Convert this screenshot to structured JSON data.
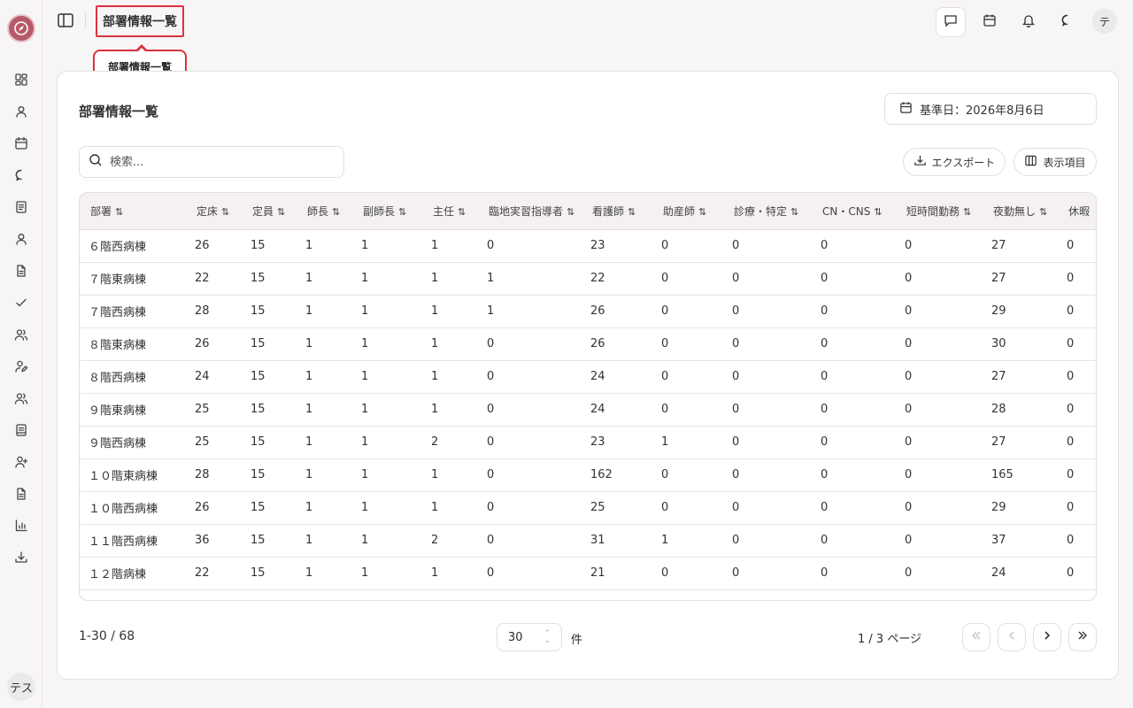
{
  "header": {
    "title": "部署情報一覧",
    "tooltip": "部署情報一覧",
    "avatar": "テ"
  },
  "sidebar": {
    "avatar": "テス",
    "icons": [
      "dashboard-icon",
      "user-icon",
      "calendar-icon",
      "chat-icon",
      "document-icon",
      "person-icon",
      "file-icon",
      "check-icon",
      "users-icon",
      "user-edit-icon",
      "group-icon",
      "notes-icon",
      "user-plus-icon",
      "report-icon",
      "bar-chart-icon",
      "download-icon"
    ]
  },
  "card": {
    "title": "部署情報一覧",
    "date_label": "基準日：2026年8月6日",
    "search_placeholder": "検索...",
    "export_label": "エクスポート",
    "columns_label": "表示項目"
  },
  "table": {
    "columns": [
      "部署",
      "定床",
      "定員",
      "師長",
      "副師長",
      "主任",
      "臨地実習指導者",
      "看護師",
      "助産師",
      "診療・特定",
      "CN・CNS",
      "短時間勤務",
      "夜勤無し",
      "休暇"
    ],
    "rows": [
      [
        "６階西病棟",
        "26",
        "15",
        "1",
        "1",
        "1",
        "0",
        "23",
        "0",
        "0",
        "0",
        "0",
        "27",
        "0"
      ],
      [
        "７階東病棟",
        "22",
        "15",
        "1",
        "1",
        "1",
        "1",
        "22",
        "0",
        "0",
        "0",
        "0",
        "27",
        "0"
      ],
      [
        "７階西病棟",
        "28",
        "15",
        "1",
        "1",
        "1",
        "1",
        "26",
        "0",
        "0",
        "0",
        "0",
        "29",
        "0"
      ],
      [
        "８階東病棟",
        "26",
        "15",
        "1",
        "1",
        "1",
        "0",
        "26",
        "0",
        "0",
        "0",
        "0",
        "30",
        "0"
      ],
      [
        "８階西病棟",
        "24",
        "15",
        "1",
        "1",
        "1",
        "0",
        "24",
        "0",
        "0",
        "0",
        "0",
        "27",
        "0"
      ],
      [
        "９階東病棟",
        "25",
        "15",
        "1",
        "1",
        "1",
        "0",
        "24",
        "0",
        "0",
        "0",
        "0",
        "28",
        "0"
      ],
      [
        "９階西病棟",
        "25",
        "15",
        "1",
        "1",
        "2",
        "0",
        "23",
        "1",
        "0",
        "0",
        "0",
        "27",
        "0"
      ],
      [
        "１０階東病棟",
        "28",
        "15",
        "1",
        "1",
        "1",
        "0",
        "162",
        "0",
        "0",
        "0",
        "0",
        "165",
        "0"
      ],
      [
        "１０階西病棟",
        "26",
        "15",
        "1",
        "1",
        "1",
        "0",
        "25",
        "0",
        "0",
        "0",
        "0",
        "29",
        "0"
      ],
      [
        "１１階西病棟",
        "36",
        "15",
        "1",
        "1",
        "2",
        "0",
        "31",
        "1",
        "0",
        "0",
        "0",
        "37",
        "0"
      ],
      [
        "１２階病棟",
        "22",
        "15",
        "1",
        "1",
        "1",
        "0",
        "21",
        "0",
        "0",
        "0",
        "0",
        "24",
        "0"
      ]
    ]
  },
  "footer": {
    "range": "1-30 / 68",
    "page_size": "30",
    "unit": "件",
    "page_info": "1 / 3 ページ"
  }
}
